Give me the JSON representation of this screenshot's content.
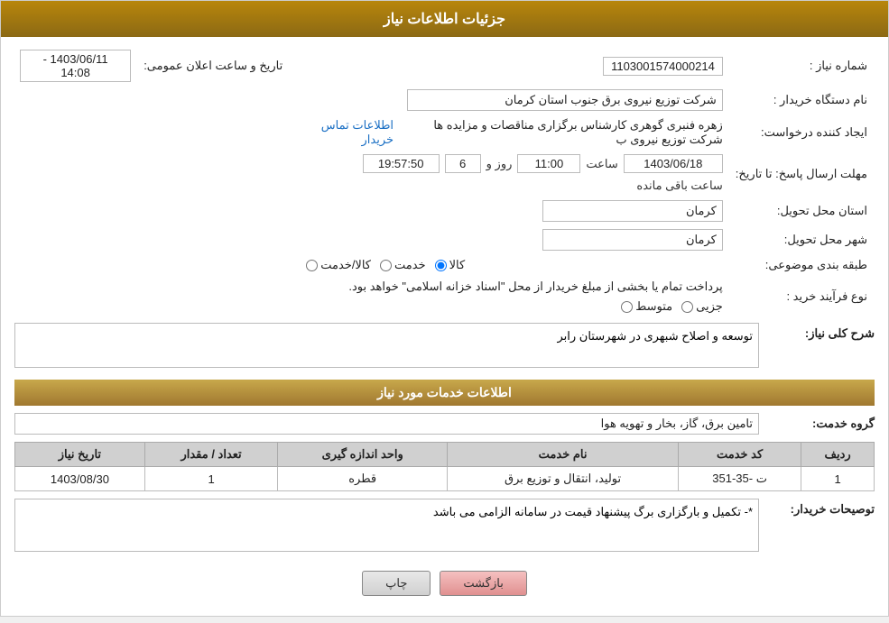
{
  "page": {
    "title": "جزئیات اطلاعات نیاز",
    "sections": {
      "main_info": "جزئیات اطلاعات نیاز",
      "services_header": "اطلاعات خدمات مورد نیاز"
    }
  },
  "fields": {
    "shomara_niaz_label": "شماره نیاز :",
    "shomara_niaz_value": "1103001574000214",
    "nam_dastgah_label": "نام دستگاه خریدار :",
    "nam_dastgah_value": "شرکت توزیع نیروی برق جنوب استان کرمان",
    "creator_label": "ایجاد کننده درخواست:",
    "creator_value": "زهره فنبری گوهری کارشناس برگزاری مناقصات و مزایده ها شرکت توزیع نیروی ب",
    "contact_link": "اطلاعات تماس خریدار",
    "deadline_label": "مهلت ارسال پاسخ: تا تاریخ:",
    "tarikh_elan_label": "تاریخ و ساعت اعلان عمومی:",
    "tarikh_elan_value": "1403/06/11 - 14:08",
    "deadline_date": "1403/06/18",
    "deadline_time": "11:00",
    "deadline_day": "6",
    "deadline_remaining": "19:57:50",
    "deadline_remaining_label": "ساعت باقی مانده",
    "ostan_label": "استان محل تحویل:",
    "ostan_value": "کرمان",
    "shahr_label": "شهر محل تحویل:",
    "shahr_value": "کرمان",
    "category_label": "طبقه بندی موضوعی:",
    "category_options": [
      "کالا",
      "خدمت",
      "کالا/خدمت"
    ],
    "category_selected": "کالا",
    "process_label": "نوع فرآیند خرید :",
    "process_options": [
      "جزیی",
      "متوسط"
    ],
    "process_note": "پرداخت تمام یا بخشی از مبلغ خریدار از محل \"اسناد خزانه اسلامی\" خواهد بود.",
    "sharh_label": "شرح کلی نیاز:",
    "sharh_value": "توسعه و اصلاح شبهری در شهرستان رابر",
    "grouh_label": "گروه خدمت:",
    "grouh_value": "تامین برق، گاز، بخار و تهویه هوا",
    "table": {
      "headers": [
        "ردیف",
        "کد خدمت",
        "نام خدمت",
        "واحد اندازه گیری",
        "تعداد / مقدار",
        "تاریخ نیاز"
      ],
      "rows": [
        {
          "radif": "1",
          "code": "ت -35-351",
          "name": "تولید، انتقال و توزیع برق",
          "unit": "قطره",
          "count": "1",
          "date": "1403/08/30"
        }
      ]
    },
    "buyer_desc_label": "توصیحات خریدار:",
    "buyer_desc_value": "*- تکمیل و بارگزاری برگ پیشنهاد قیمت در سامانه الزامی می باشد",
    "buttons": {
      "print": "چاپ",
      "back": "بازگشت"
    }
  }
}
